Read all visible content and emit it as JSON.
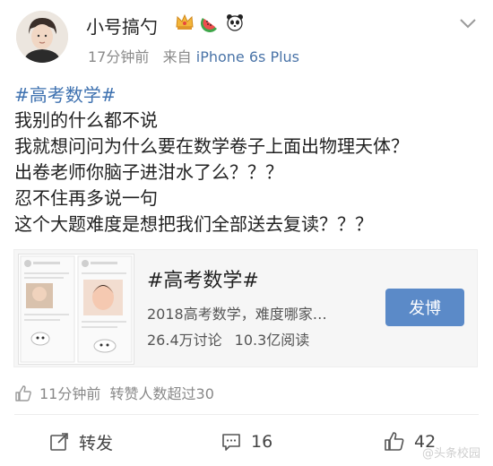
{
  "header": {
    "username": "小号搞勺",
    "badges": [
      "crown-icon",
      "watermelon-icon",
      "panda-icon"
    ],
    "timestamp": "17分钟前",
    "source_prefix": "来自",
    "source_device": "iPhone 6s Plus"
  },
  "post": {
    "hashtag": "#高考数学#",
    "lines": [
      "我别的什么都不说",
      "我就想问问为什么要在数学卷子上面出物理天体？",
      "出卷老师你脑子进泔水了么？？？",
      "忍不住再多说一句",
      "这个大题难度是想把我们全部送去复读？？？"
    ]
  },
  "topic_card": {
    "title": "#高考数学#",
    "description": "2018高考数学，难度哪家…",
    "discussions": "26.4万讨论",
    "reads": "10.3亿阅读",
    "button_label": "发博"
  },
  "like_summary": {
    "time": "11分钟前",
    "text": "转赞人数超过30"
  },
  "actions": {
    "repost_label": "转发",
    "comment_count": "16",
    "like_count": "42"
  },
  "watermark": "@头条校园",
  "colors": {
    "link": "#3f72b0",
    "button": "#5b8ac8",
    "meta": "#8a8a8a"
  }
}
